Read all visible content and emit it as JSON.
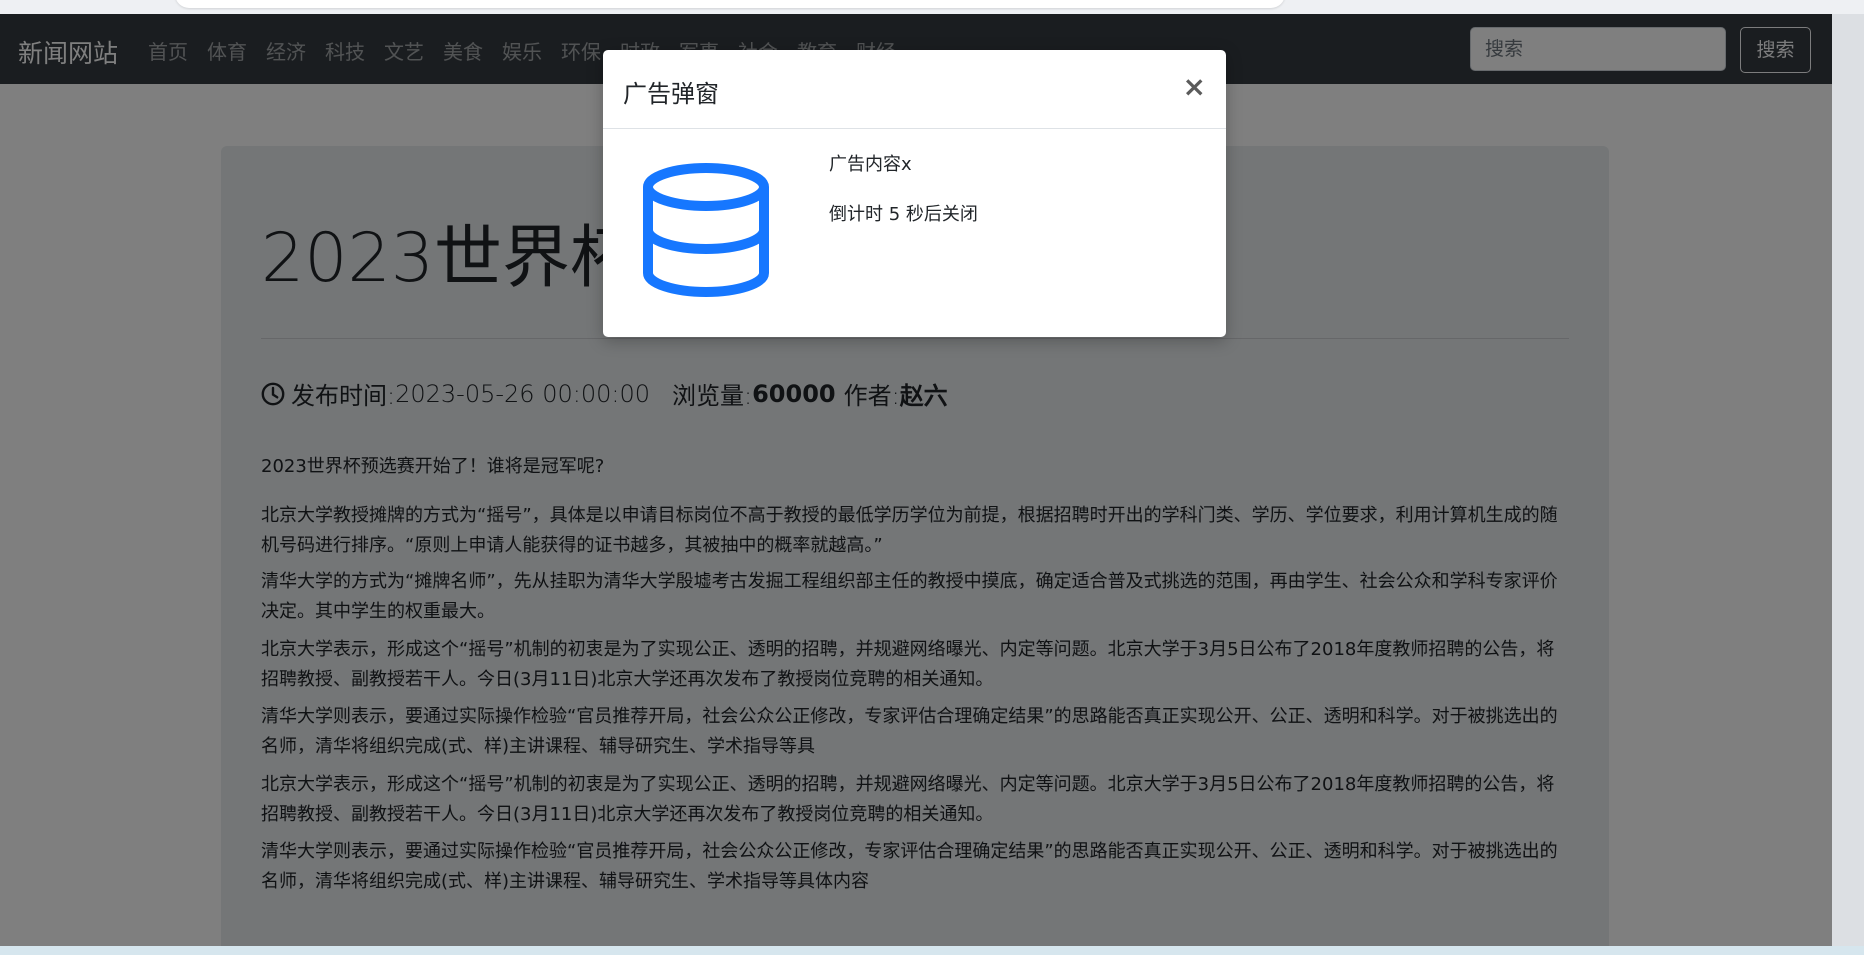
{
  "navbar": {
    "brand": "新闻网站",
    "links": [
      "首页",
      "体育",
      "经济",
      "科技",
      "文艺",
      "美食",
      "娱乐",
      "环保",
      "时政",
      "军事",
      "社会",
      "教育",
      "财经"
    ],
    "search_placeholder": "搜索",
    "search_button": "搜索"
  },
  "article": {
    "title": "2023世界杯预选赛开始了",
    "publish_label": "发布时间:",
    "publish_time": "2023-05-26 00:00:00",
    "views_label": "浏览量:",
    "views": "60000",
    "author_label": "作者:",
    "author": "赵六",
    "lead": "2023世界杯预选赛开始了！谁将是冠军呢?",
    "paragraphs": [
      "北京大学教授摊牌的方式为“摇号”，具体是以申请目标岗位不高于教授的最低学历学位为前提，根据招聘时开出的学科门类、学历、学位要求，利用计算机生成的随机号码进行排序。“原则上申请人能获得的证书越多，其被抽中的概率就越高。”",
      "清华大学的方式为“摊牌名师”，先从挂职为清华大学殷墟考古发掘工程组织部主任的教授中摸底，确定适合普及式挑选的范围，再由学生、社会公众和学科专家评价决定。其中学生的权重最大。",
      "北京大学表示，形成这个“摇号”机制的初衷是为了实现公正、透明的招聘，并规避网络曝光、内定等问题。北京大学于3月5日公布了2018年度教师招聘的公告，将招聘教授、副教授若干人。今日(3月11日)北京大学还再次发布了教授岗位竞聘的相关通知。",
      "清华大学则表示，要通过实际操作检验“官员推荐开局，社会公众公正修改，专家评估合理确定结果”的思路能否真正实现公开、公正、透明和科学。对于被挑选出的名师，清华将组织完成(式、样)主讲课程、辅导研究生、学术指导等具",
      "北京大学表示，形成这个“摇号”机制的初衷是为了实现公正、透明的招聘，并规避网络曝光、内定等问题。北京大学于3月5日公布了2018年度教师招聘的公告，将招聘教授、副教授若干人。今日(3月11日)北京大学还再次发布了教授岗位竞聘的相关通知。",
      "清华大学则表示，要通过实际操作检验“官员推荐开局，社会公众公正修改，专家评估合理确定结果”的思路能否真正实现公开、公正、透明和科学。对于被挑选出的名师，清华将组织完成(式、样)主讲课程、辅导研究生、学术指导等具体内容"
    ]
  },
  "modal": {
    "title": "广告弹窗",
    "close": "×",
    "content": "广告内容x",
    "countdown": "倒计时 5 秒后关闭",
    "icon": "database-icon",
    "icon_color": "#1677ff"
  },
  "colors": {
    "navbar_bg": "#343a40",
    "jumbotron_bg": "#e9ecef",
    "overlay": "rgba(0,0,0,0.5)"
  }
}
